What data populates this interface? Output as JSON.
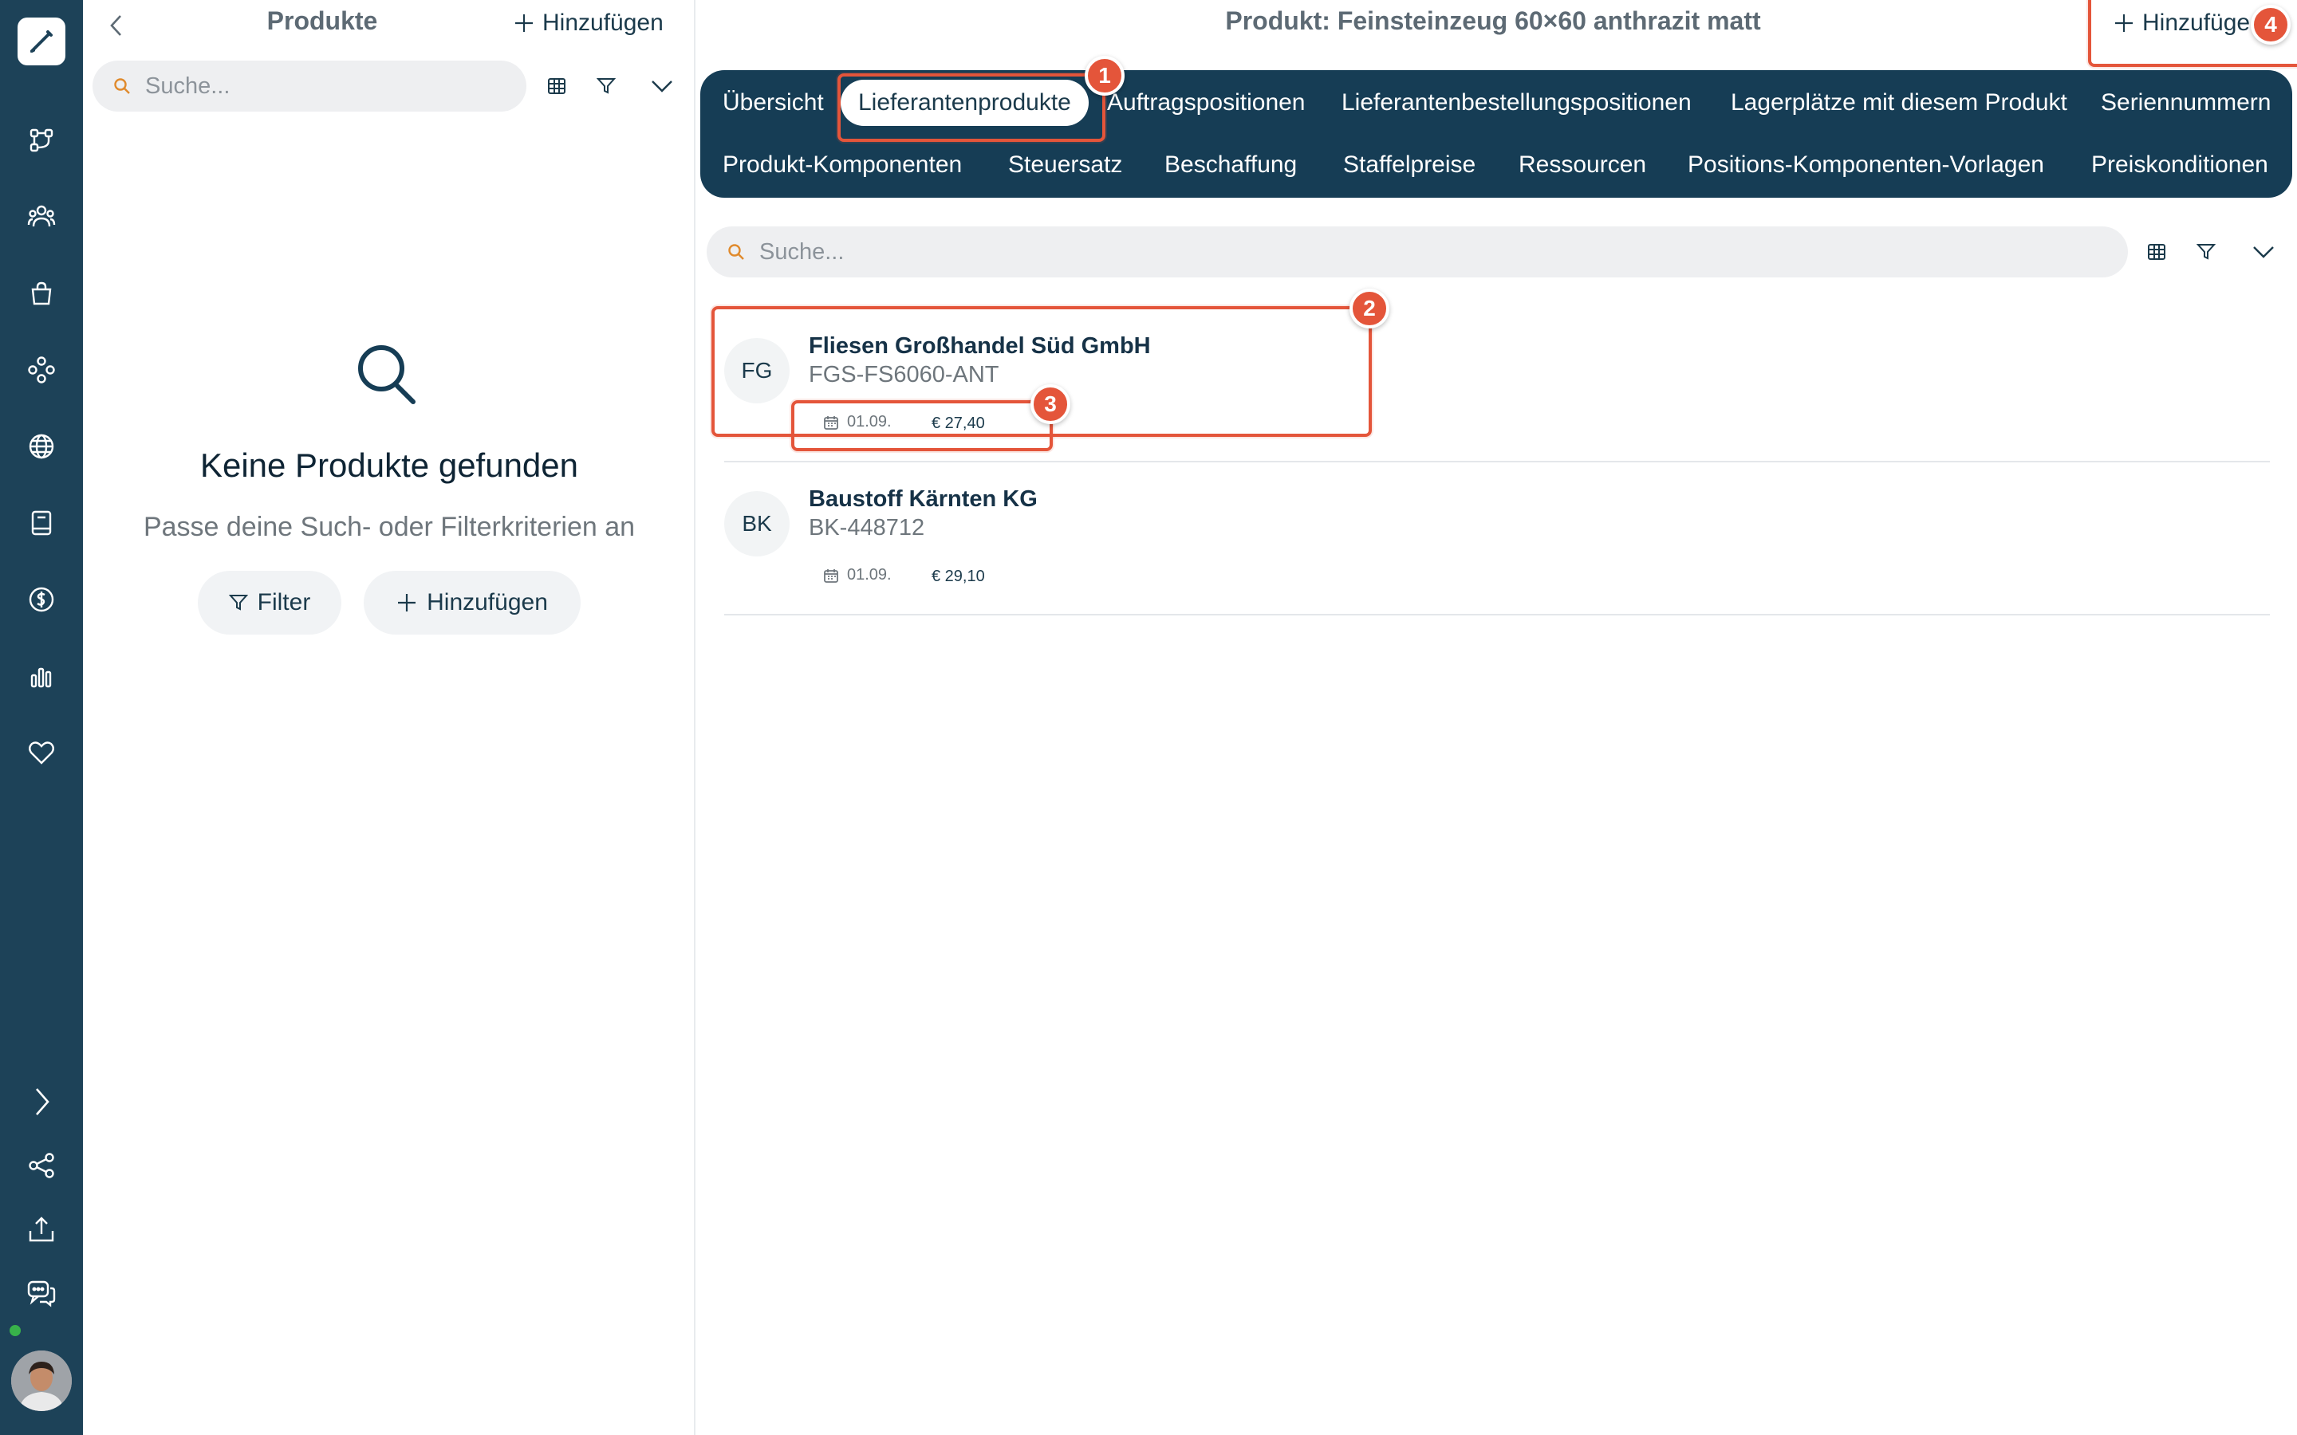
{
  "rail": {
    "items": [
      {
        "icon": "flow-icon"
      },
      {
        "icon": "users-icon"
      },
      {
        "icon": "shopping-bag-icon"
      },
      {
        "icon": "components-icon"
      },
      {
        "icon": "globe-icon"
      },
      {
        "icon": "book-icon"
      },
      {
        "icon": "dollar-icon"
      },
      {
        "icon": "bar-chart-icon"
      },
      {
        "icon": "heart-icon"
      }
    ],
    "bottom": [
      {
        "icon": "chevron-right-icon"
      },
      {
        "icon": "share-icon"
      },
      {
        "icon": "upload-icon"
      },
      {
        "icon": "chat-icon"
      }
    ],
    "status_color": "#38b24a"
  },
  "products_panel": {
    "title": "Produkte",
    "add_label": "Hinzufügen",
    "search_placeholder": "Suche...",
    "empty": {
      "title": "Keine Produkte gefunden",
      "subtitle": "Passe deine Such- oder Filterkriterien an",
      "filter_label": "Filter",
      "add_label": "Hinzufügen"
    }
  },
  "main": {
    "title": "Produkt: Feinsteinzeug 60×60 anthrazit matt",
    "add_label": "Hinzufüge",
    "tabs_row1": [
      {
        "label": "Übersicht"
      },
      {
        "label": "Lieferantenprodukte",
        "active": true
      },
      {
        "label": "Auftragspositionen"
      },
      {
        "label": "Lieferantenbestellungspositionen"
      },
      {
        "label": "Lagerplätze mit diesem Produkt"
      },
      {
        "label": "Seriennummern"
      }
    ],
    "tabs_row2": [
      {
        "label": "Produkt-Komponenten"
      },
      {
        "label": "Steuersatz"
      },
      {
        "label": "Beschaffung"
      },
      {
        "label": "Staffelpreise"
      },
      {
        "label": "Ressourcen"
      },
      {
        "label": "Positions-Komponenten-Vorlagen"
      },
      {
        "label": "Preiskonditionen"
      }
    ],
    "search_placeholder": "Suche...",
    "rows": [
      {
        "initials": "FG",
        "name": "Fliesen Großhandel Süd GmbH",
        "code": "FGS-FS6060-ANT",
        "date": "01.09.",
        "price": "€ 27,40"
      },
      {
        "initials": "BK",
        "name": "Baustoff Kärnten KG",
        "code": "BK-448712",
        "date": "01.09.",
        "price": "€ 29,10"
      }
    ]
  },
  "annotations": {
    "badges": [
      "1",
      "2",
      "3",
      "4"
    ],
    "color": "#e4553a"
  },
  "colors": {
    "rail": "#1d4258",
    "tabbar": "#163d55",
    "accent_orange": "#e4553a"
  }
}
